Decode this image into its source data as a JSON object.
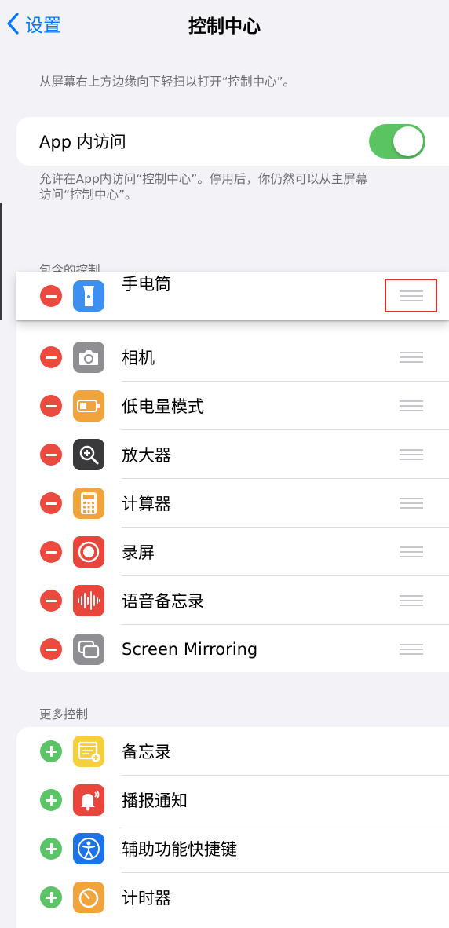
{
  "nav": {
    "back_label": "设置",
    "title": "控制中心"
  },
  "intro_text": "从屏幕右上方边缘向下轻扫以打开“控制中心”。",
  "app_access": {
    "label": "App 内访问",
    "enabled": true,
    "footer_line1": "允许在App内访问“控制中心”。停用后，你仍然可以从主屏幕",
    "footer_line2": "访问“控制中心”。"
  },
  "included": {
    "header": "包含的控制",
    "dragging_item": {
      "label": "手电筒",
      "icon": "flashlight-icon",
      "color": "#3d8ff0"
    },
    "items": [
      {
        "label": "相机",
        "icon": "camera-icon",
        "color": "#8e8e93"
      },
      {
        "label": "低电量模式",
        "icon": "battery-icon",
        "color": "#f0a43b"
      },
      {
        "label": "放大器",
        "icon": "magnifier-icon",
        "color": "#3a3a3c"
      },
      {
        "label": "计算器",
        "icon": "calculator-icon",
        "color": "#f0a43b"
      },
      {
        "label": "录屏",
        "icon": "screen-record-icon",
        "color": "#e8453c"
      },
      {
        "label": "语音备忘录",
        "icon": "voice-memo-icon",
        "color": "#e8453c"
      },
      {
        "label": "Screen Mirroring",
        "icon": "screen-mirroring-icon",
        "color": "#8e8e93"
      }
    ]
  },
  "more": {
    "header": "更多控制",
    "items": [
      {
        "label": "备忘录",
        "icon": "notes-icon",
        "color": "#f5cf3c"
      },
      {
        "label": "播报通知",
        "icon": "announce-notifications-icon",
        "color": "#e8453c"
      },
      {
        "label": "辅助功能快捷键",
        "icon": "accessibility-icon",
        "color": "#1c73e8"
      },
      {
        "label": "计时器",
        "icon": "timer-icon",
        "color": "#f0a43b"
      }
    ]
  }
}
